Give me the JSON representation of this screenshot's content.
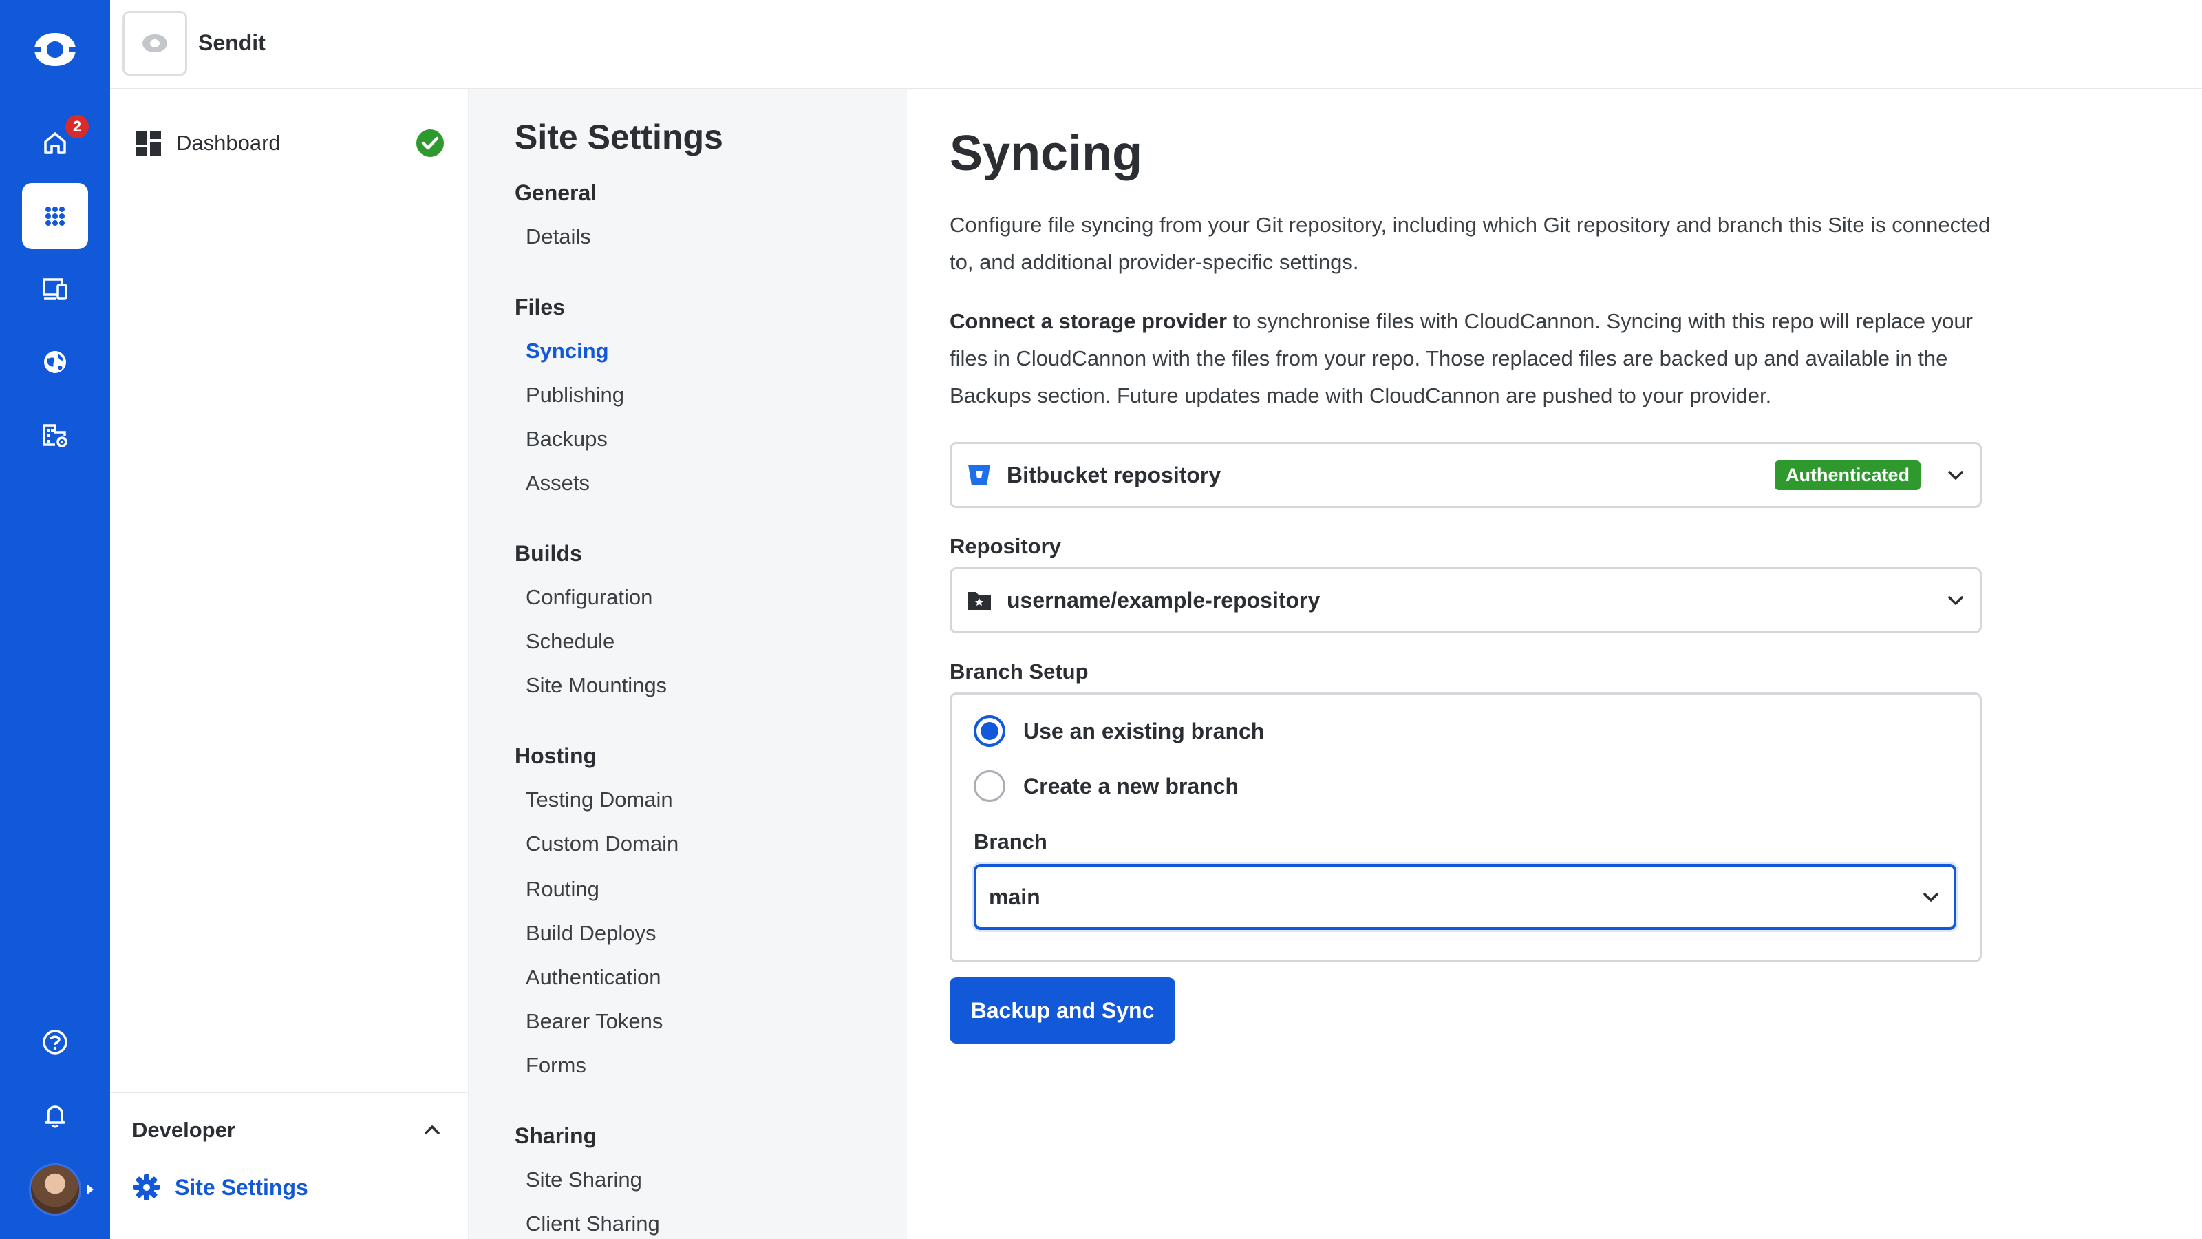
{
  "rail": {
    "home_badge": "2",
    "items": [
      "cloudcannon-logo",
      "home-icon",
      "apps-icon",
      "devices-icon",
      "globe-icon",
      "organization-icon",
      "help-icon",
      "bell-icon"
    ]
  },
  "header": {
    "site_name": "Sendit"
  },
  "sidebar": {
    "dashboard_label": "Dashboard",
    "developer_label": "Developer",
    "site_settings_label": "Site Settings"
  },
  "settings_nav": {
    "title": "Site Settings",
    "groups": [
      {
        "title": "General",
        "items": [
          "Details"
        ]
      },
      {
        "title": "Files",
        "items": [
          "Syncing",
          "Publishing",
          "Backups",
          "Assets"
        ]
      },
      {
        "title": "Builds",
        "items": [
          "Configuration",
          "Schedule",
          "Site Mountings"
        ]
      },
      {
        "title": "Hosting",
        "items": [
          "Testing Domain",
          "Custom Domain",
          "Routing",
          "Build Deploys",
          "Authentication",
          "Bearer Tokens",
          "Forms"
        ]
      },
      {
        "title": "Sharing",
        "items": [
          "Site Sharing",
          "Client Sharing"
        ]
      }
    ],
    "active_item": "Syncing"
  },
  "main": {
    "title": "Syncing",
    "intro": "Configure file syncing from your Git repository, including which Git repository and branch this Site is connected to, and additional provider-specific settings.",
    "connect_bold": "Connect a storage provider",
    "connect_rest": " to synchronise files with CloudCannon. Syncing with this repo will replace your files in CloudCannon with the files from your repo. Those replaced files are backed up and available in the Backups section. Future updates made with CloudCannon are pushed to your provider.",
    "provider": {
      "name": "Bitbucket repository",
      "status": "Authenticated"
    },
    "repository_label": "Repository",
    "repository_value": "username/example-repository",
    "branch_setup_label": "Branch Setup",
    "radio_existing": "Use an existing branch",
    "radio_new": "Create a new branch",
    "branch_label": "Branch",
    "branch_value": "main",
    "submit_label": "Backup and Sync"
  },
  "colors": {
    "brand_blue": "#1159d8",
    "success_green": "#2e9a2e",
    "badge_red": "#d92b2b"
  }
}
